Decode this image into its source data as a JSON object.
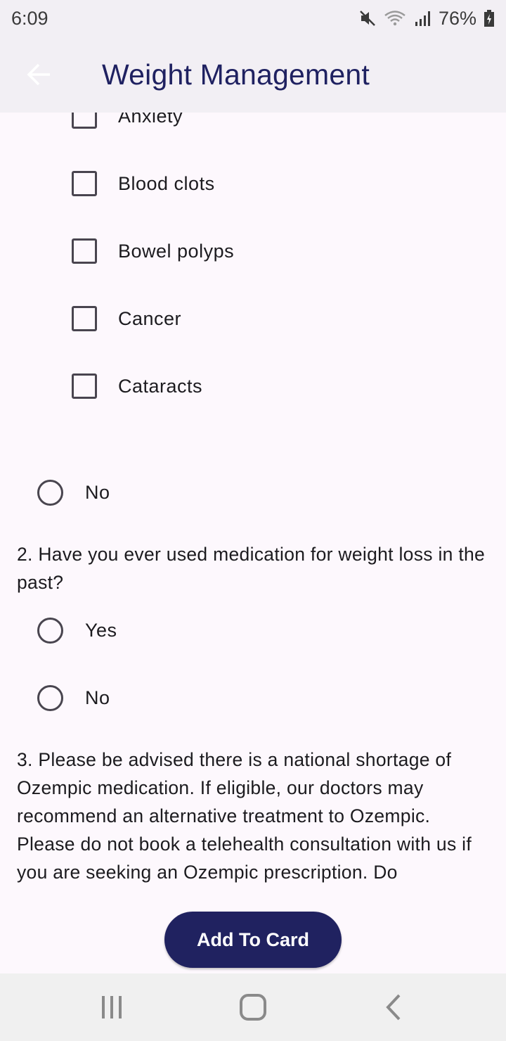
{
  "status_bar": {
    "time": "6:09",
    "battery": "76%",
    "icons": [
      "mute-icon",
      "wifi-icon",
      "signal-icon",
      "battery-charging-icon"
    ]
  },
  "app_bar": {
    "title": "Weight Management",
    "back_icon": "arrow-left-icon"
  },
  "conditions": [
    {
      "label": "Anxiety",
      "checked": false
    },
    {
      "label": "Blood clots",
      "checked": false
    },
    {
      "label": "Bowel polyps",
      "checked": false
    },
    {
      "label": "Cancer",
      "checked": false
    },
    {
      "label": "Cataracts",
      "checked": false
    }
  ],
  "q1": {
    "no_label": "No"
  },
  "q2": {
    "text": "2. Have you ever used medication for weight loss in the past?",
    "options": [
      "Yes",
      "No"
    ]
  },
  "q3": {
    "text": "3. Please be advised there is a national shortage of Ozempic medication. If eligible, our doctors may recommend an alternative treatment to Ozempic. Please do not book a telehealth consultation with us if you are seeking an Ozempic prescription. Do"
  },
  "actions": {
    "add_label": "Add To Card"
  },
  "colors": {
    "primary": "#202260",
    "title": "#1f2161",
    "surface": "#fdf8fd",
    "app_bar": "#f2eff4"
  },
  "nav": {
    "icons": [
      "recent-apps-icon",
      "home-icon",
      "back-icon"
    ]
  }
}
